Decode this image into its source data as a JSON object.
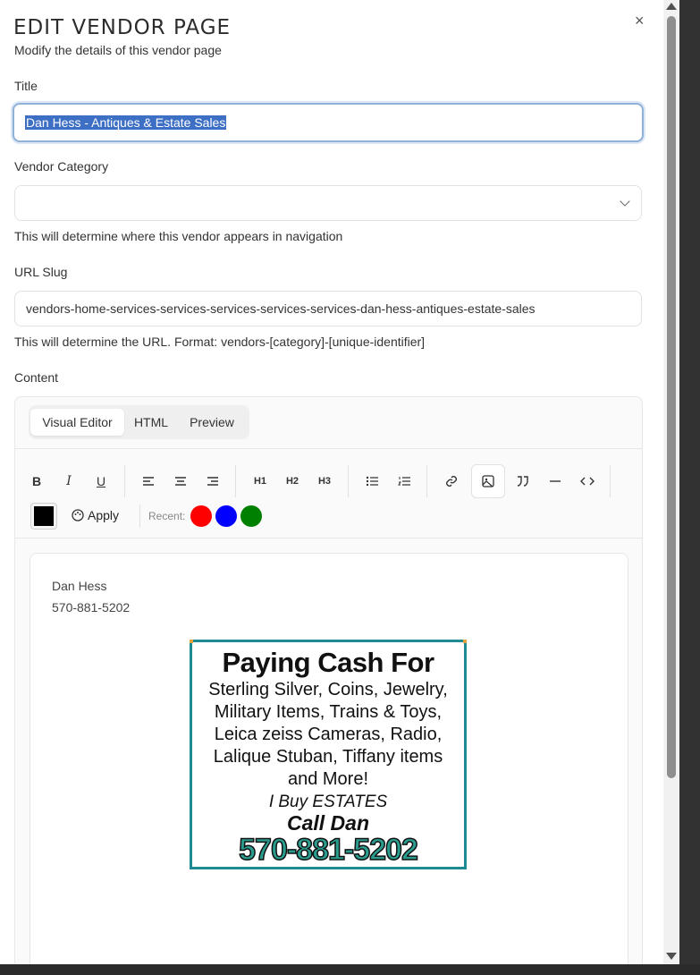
{
  "modal": {
    "title": "EDIT VENDOR PAGE",
    "subtitle": "Modify the details of this vendor page",
    "close_label": "×"
  },
  "fields": {
    "title_label": "Title",
    "title_value": "Dan Hess - Antiques & Estate Sales",
    "category_label": "Vendor Category",
    "category_value": "",
    "category_help": "This will determine where this vendor appears in navigation",
    "slug_label": "URL Slug",
    "slug_value": "vendors-home-services-services-services-services-services-dan-hess-antiques-estate-sales",
    "slug_help": "This will determine the URL. Format: vendors-[category]-[unique-identifier]",
    "content_label": "Content"
  },
  "editor_tabs": [
    {
      "label": "Visual Editor",
      "active": true
    },
    {
      "label": "HTML",
      "active": false
    },
    {
      "label": "Preview",
      "active": false
    }
  ],
  "toolbar": {
    "bold": "B",
    "italic": "I",
    "underline": "U",
    "h1": "H1",
    "h2": "H2",
    "h3": "H3",
    "apply_label": "Apply",
    "recent_label": "Recent:",
    "text_color": "#000000",
    "recent_colors": [
      "#ff0000",
      "#0000ff",
      "#008000"
    ]
  },
  "content": {
    "line1": "Dan Hess",
    "line2": "570-881-5202",
    "ad": {
      "headline": "Paying Cash For",
      "lines": [
        "Sterling Silver, Coins, Jewelry,",
        "Military Items, Trains & Toys,",
        "Leica zeiss Cameras, Radio,",
        "Lalique Stuban, Tiffany items",
        "and More!"
      ],
      "buy": "I Buy ESTATES",
      "call": "Call Dan",
      "phone": "570-881-5202"
    }
  }
}
